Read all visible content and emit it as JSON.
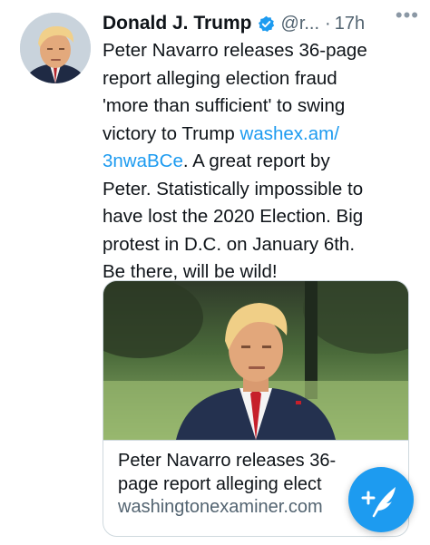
{
  "tweet": {
    "author_name": "Donald J. Trump",
    "handle": "@r...",
    "separator": "·",
    "time": "17h",
    "more_label": "•••",
    "body_lines": [
      "Peter Navarro releases 36-page",
      "report alleging election fraud",
      "'more than sufficient' to swing",
      "victory to Trump ",
      "washex.am/",
      "3nwaBCe",
      ". A great report by",
      "Peter. Statistically impossible to",
      "have lost the 2020 Election. Big",
      "protest in D.C. on January 6th.",
      "Be there, will be wild!"
    ]
  },
  "card": {
    "title_line1": "Peter Navarro releases 36-",
    "title_line2": "page report alleging elect",
    "domain": "washingtonexaminer.com"
  },
  "colors": {
    "link": "#1d9bf0",
    "verified": "#1d9bf0",
    "fab": "#1d9bf0",
    "secondary_text": "#536471"
  },
  "icons": {
    "verified": "verified-badge-icon",
    "more": "more-options-icon",
    "compose": "compose-tweet-icon"
  }
}
